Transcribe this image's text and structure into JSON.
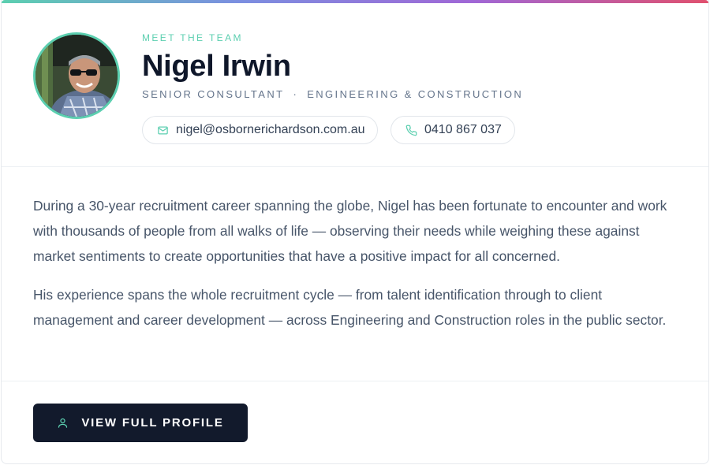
{
  "colors": {
    "accent_teal": "#5ccfb0",
    "accent_gradient": [
      "#5ccfb0",
      "#7b8fe0",
      "#a067d6",
      "#e0506e"
    ],
    "heading": "#0f172a",
    "body_text": "#475569",
    "button_bg": "#121a2c"
  },
  "profile": {
    "eyebrow": "MEET THE TEAM",
    "name": "Nigel Irwin",
    "title": "SENIOR CONSULTANT",
    "separator": "·",
    "sector": "ENGINEERING & CONSTRUCTION",
    "email": "nigel@osbornerichardson.com.au",
    "phone": "0410 867 037",
    "email_icon": "mail-icon",
    "phone_icon": "phone-icon"
  },
  "bio": {
    "paragraphs": [
      "During a 30-year recruitment career spanning the globe, Nigel has been fortunate to encounter and work with thousands of people from all walks of life — observing their needs while weighing these against market sentiments to create opportunities that have a positive impact for all concerned.",
      "His experience spans the whole recruitment cycle — from talent identification through to client management and career development — across Engineering and Construction roles in the public sector."
    ]
  },
  "cta": {
    "label": "VIEW FULL PROFILE",
    "icon": "user-icon"
  }
}
